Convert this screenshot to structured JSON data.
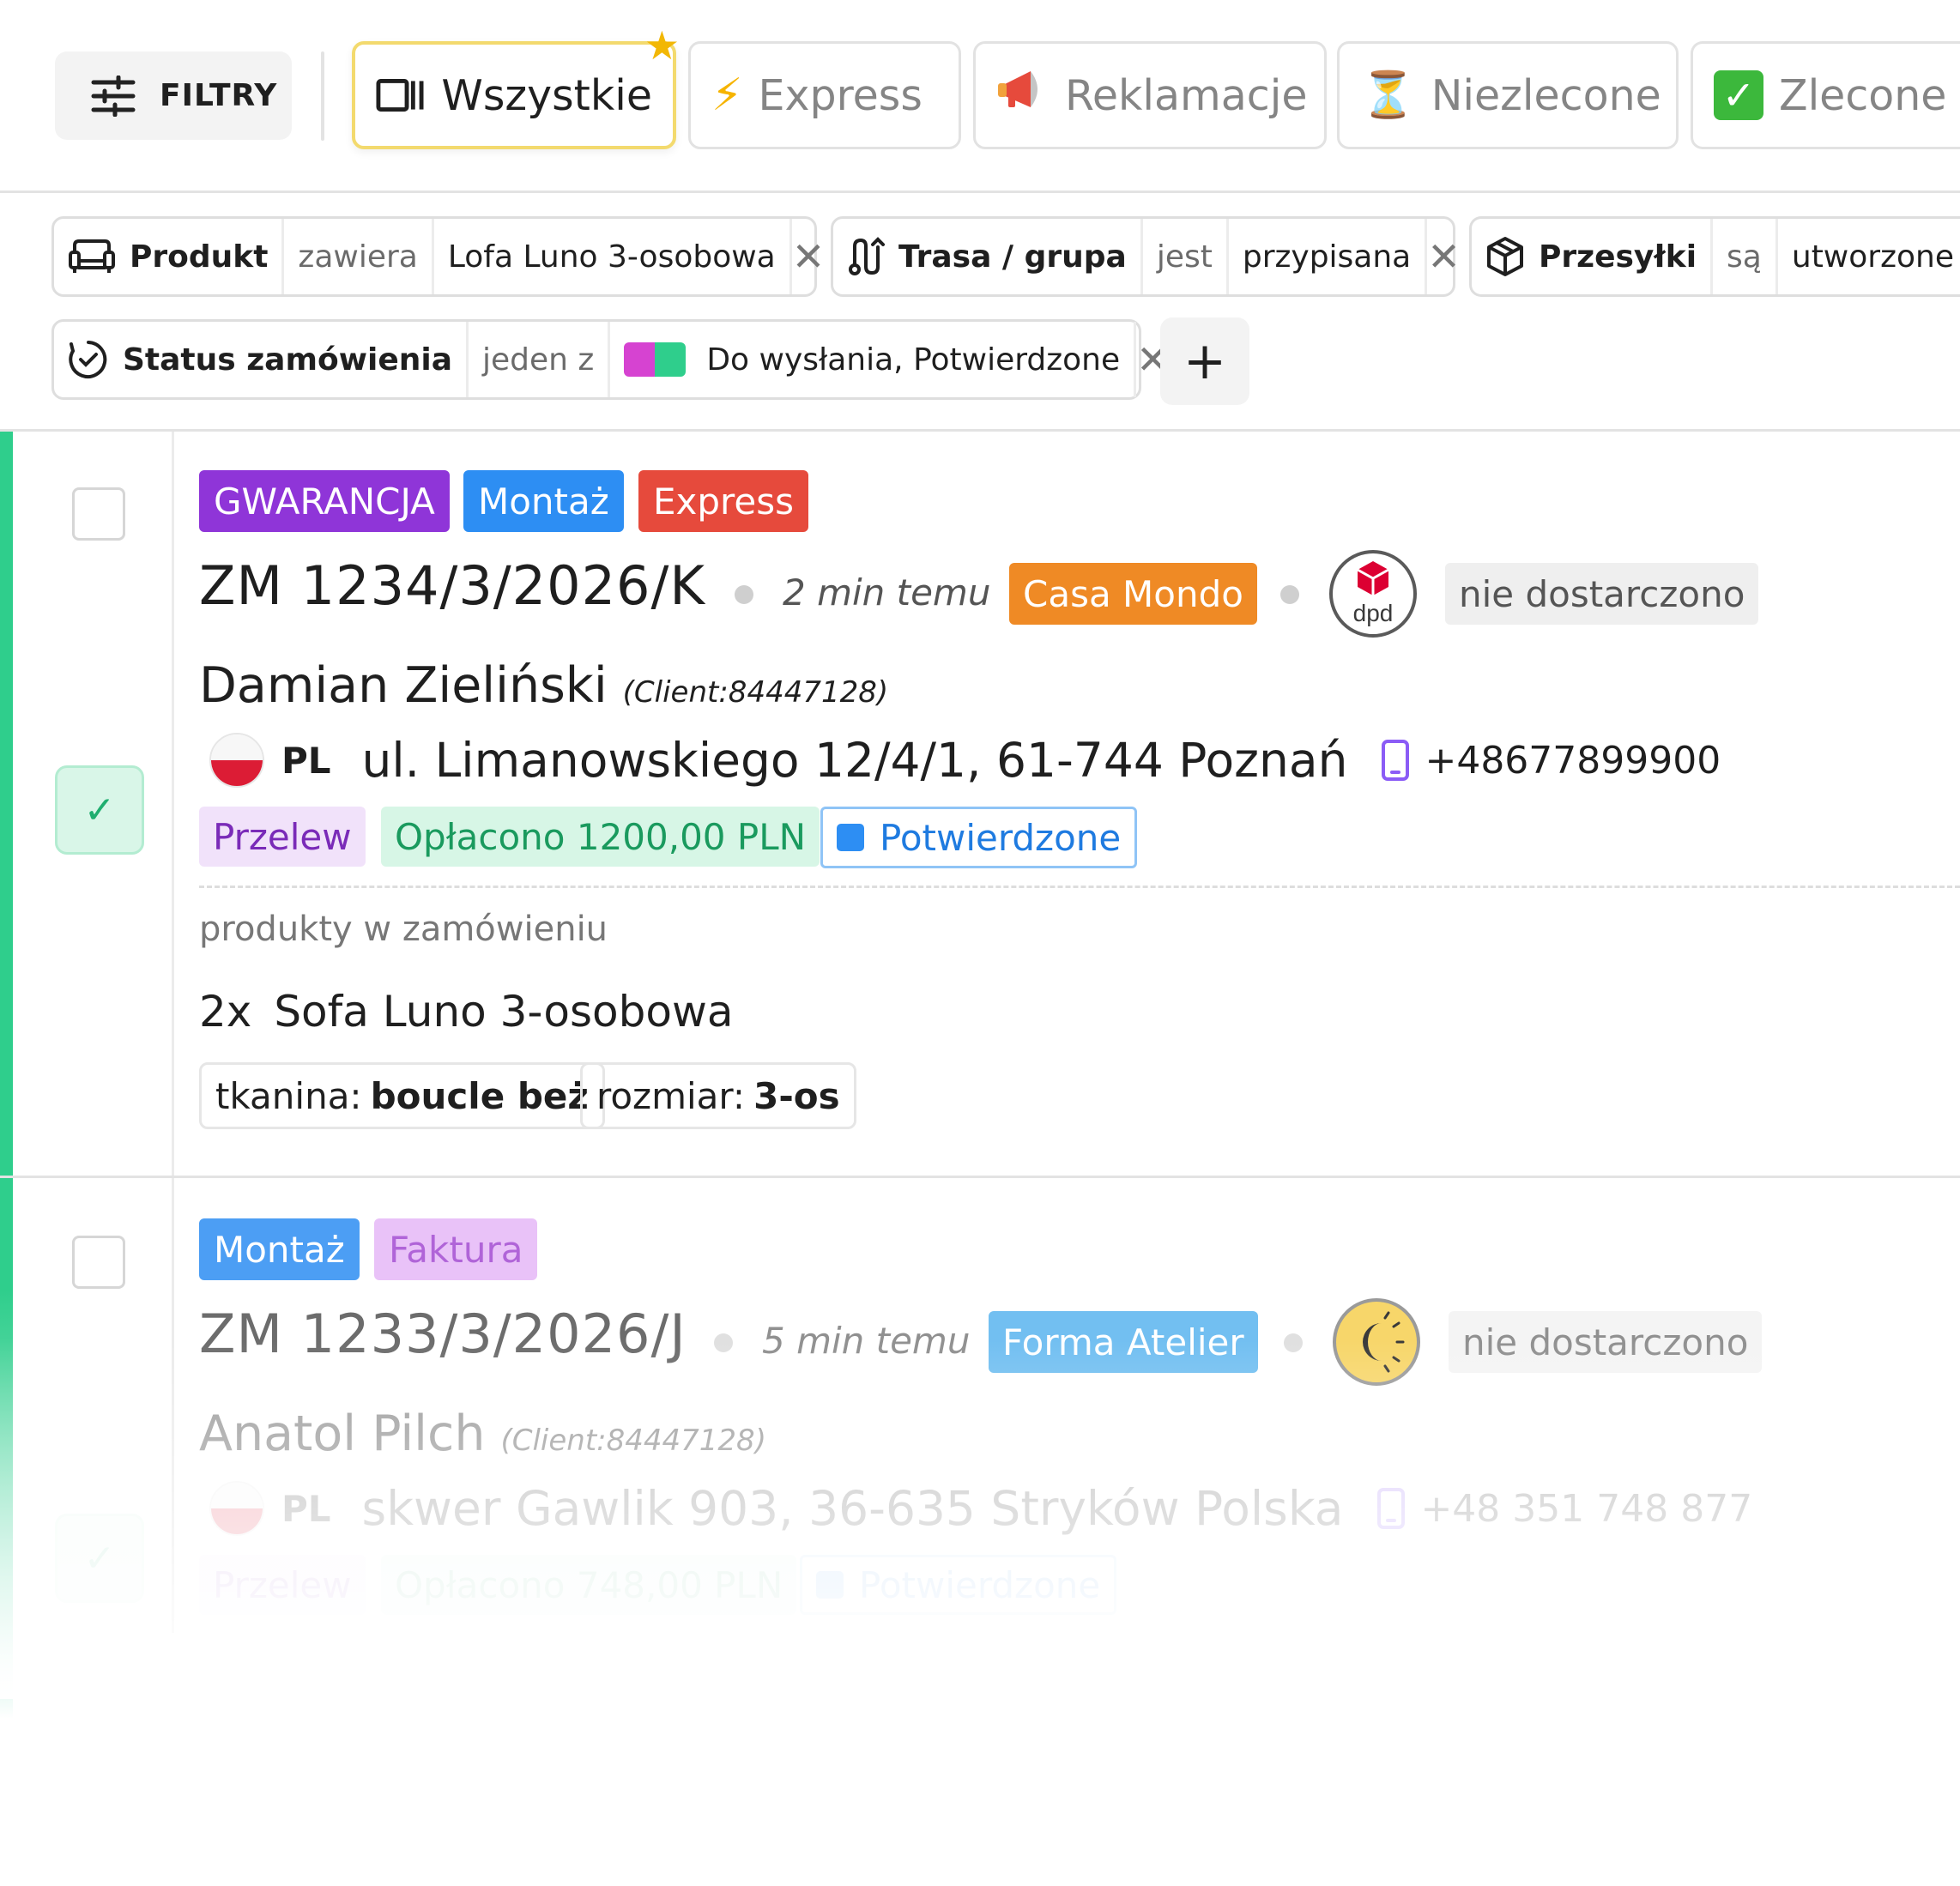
{
  "toolbar": {
    "filters_label": "FILTRY",
    "tabs": [
      {
        "label": "Wszystkie",
        "icon": "columns-icon",
        "active": true,
        "starred": true
      },
      {
        "label": "Express",
        "icon": "lightning-emoji"
      },
      {
        "label": "Reklamacje",
        "icon": "megaphone-emoji"
      },
      {
        "label": "Niezlecone",
        "icon": "hourglass-emoji"
      },
      {
        "label": "Zlecone",
        "icon": "check-mark-emoji"
      }
    ]
  },
  "filters": [
    {
      "field": "Produkt",
      "icon": "sofa-icon",
      "operator": "zawiera",
      "value": "Lofa Luno 3-osobowa"
    },
    {
      "field": "Trasa / grupa",
      "icon": "route-icon",
      "operator": "jest",
      "value": "przypisana"
    },
    {
      "field": "Przesyłki",
      "icon": "package-icon",
      "operator": "są",
      "value": "utworzone"
    },
    {
      "field": "Status zamówienia",
      "icon": "status-check-icon",
      "operator": "jeden z",
      "value": "Do wysłania, Potwierdzone",
      "swatches": [
        "#d643d1",
        "#2fce8c"
      ]
    }
  ],
  "add_filter_label": "+",
  "orders": [
    {
      "selected": true,
      "tags": [
        {
          "label": "GWARANCJA",
          "color": "#8f35d8"
        },
        {
          "label": "Montaż",
          "color": "#2d8ef3"
        },
        {
          "label": "Express",
          "color": "#e64a3c"
        }
      ],
      "number": "ZM 1234/3/2026/K",
      "time_ago": "2 min temu",
      "store": {
        "label": "Casa Mondo",
        "color": "#ef8a25"
      },
      "carrier": {
        "name": "dpd",
        "icon": "dpd-logo"
      },
      "delivery_status": "nie dostarczono",
      "customer": {
        "name": "Damian Zieliński",
        "client_id": "(Client:84447128)"
      },
      "country": "PL",
      "address": "ul. Limanowskiego 12/4/1, 61-744 Poznań",
      "phone": "+48677899900",
      "payment": {
        "method": "Przelew",
        "paid": "Opłacono 1200,00 PLN",
        "status": "Potwierdzone"
      },
      "products_label": "produkty w zamówieniu",
      "products": [
        {
          "qty": "2x",
          "name": "Sofa Luno 3-osobowa",
          "attributes": [
            {
              "key": "tkanina:",
              "value": "boucle beż"
            },
            {
              "key": "rozmiar:",
              "value": "3-os"
            }
          ]
        }
      ]
    },
    {
      "selected": true,
      "tags": [
        {
          "label": "Montaż",
          "color": "#2d8ef3"
        },
        {
          "label": "Faktura",
          "color": "#d99af0"
        }
      ],
      "number": "ZM 1233/3/2026/J",
      "time_ago": "5 min temu",
      "store": {
        "label": "Forma Atelier",
        "color": "#3aa6ef"
      },
      "carrier": {
        "name": "moon-sun",
        "icon": "sun-moon-logo"
      },
      "delivery_status": "nie dostarczono",
      "customer": {
        "name": "Anatol Pilch",
        "client_id": "(Client:84447128)"
      },
      "country": "PL",
      "address": "skwer Gawlik 903, 36-635 Stryków Polska",
      "phone": "+48 351 748 877",
      "payment": {
        "method": "Przelew",
        "paid": "Opłacono 748,00 PLN",
        "status": "Potwierdzone"
      }
    }
  ]
}
